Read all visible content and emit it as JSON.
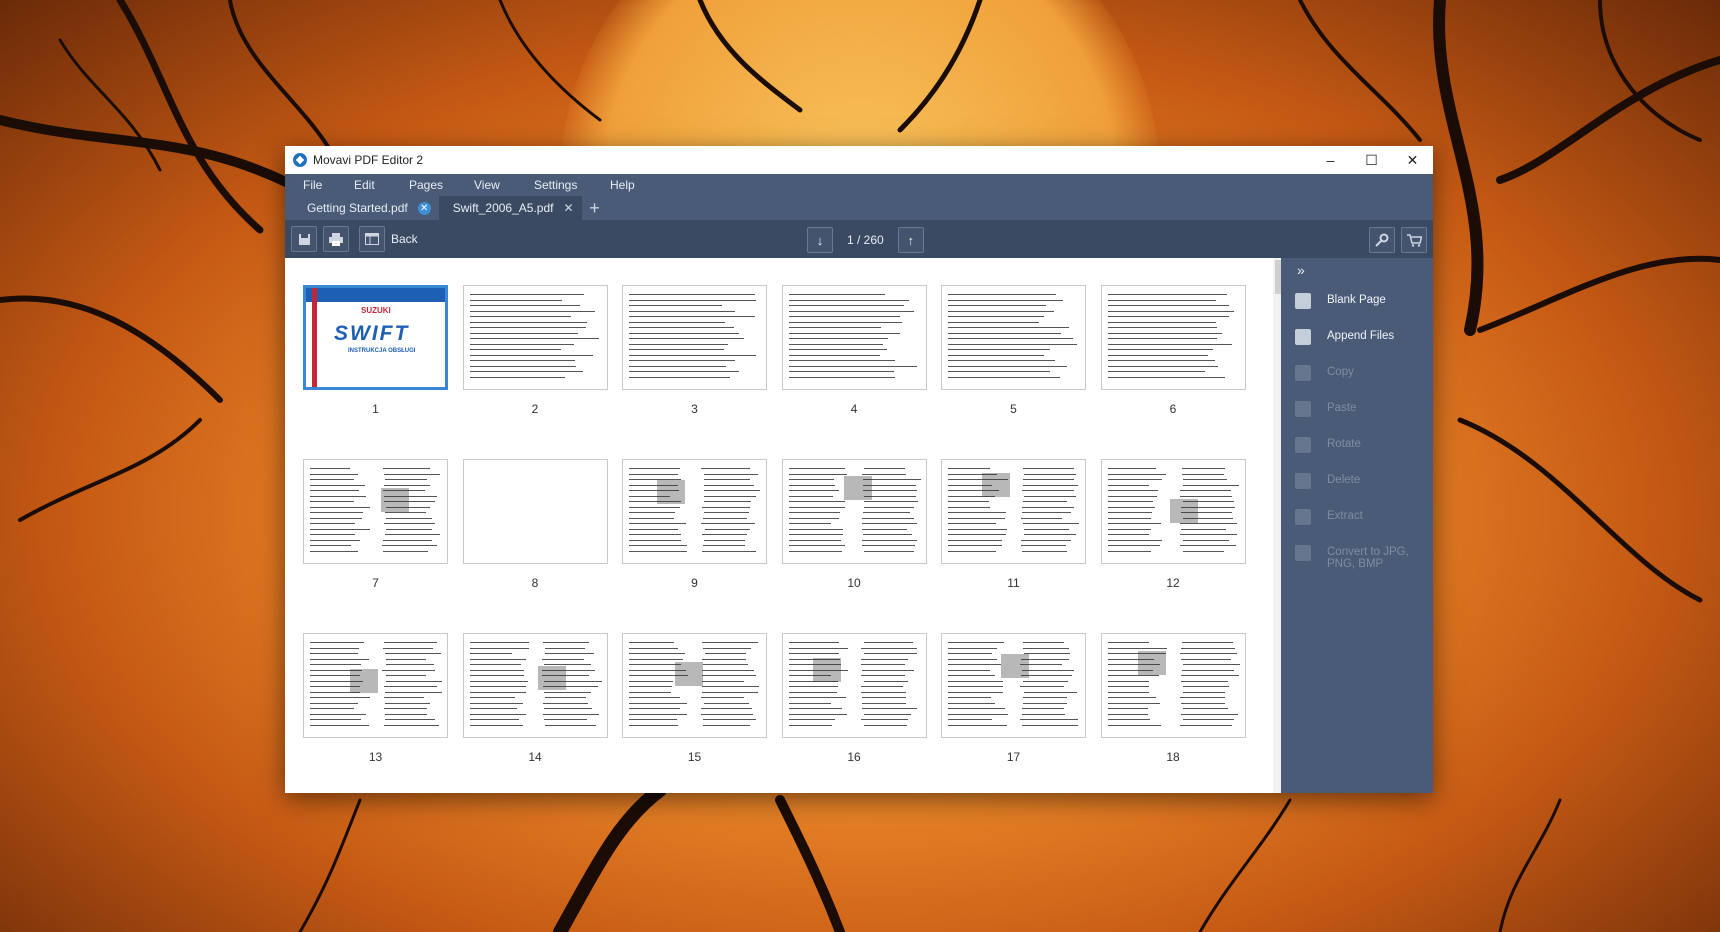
{
  "window": {
    "title": "Movavi PDF Editor 2"
  },
  "menu": [
    "File",
    "Edit",
    "Pages",
    "View",
    "Settings",
    "Help"
  ],
  "tabs": [
    {
      "label": "Getting Started.pdf",
      "active": false
    },
    {
      "label": "Swift_2006_A5.pdf",
      "active": true
    }
  ],
  "toolbar": {
    "back_label": "Back",
    "page_indicator": "1 / 260"
  },
  "pages": [
    {
      "number": "1",
      "selected": true,
      "cover": {
        "brand": "SUZUKI",
        "title": "SWIFT",
        "subtitle": "INSTRUKCJA OBSŁUGI"
      }
    },
    {
      "number": "2"
    },
    {
      "number": "3"
    },
    {
      "number": "4"
    },
    {
      "number": "5"
    },
    {
      "number": "6"
    },
    {
      "number": "7"
    },
    {
      "number": "8"
    },
    {
      "number": "9"
    },
    {
      "number": "10"
    },
    {
      "number": "11"
    },
    {
      "number": "12"
    },
    {
      "number": "13"
    },
    {
      "number": "14"
    },
    {
      "number": "15"
    },
    {
      "number": "16"
    },
    {
      "number": "17"
    },
    {
      "number": "18"
    }
  ],
  "sidebar": {
    "items": [
      {
        "label": "Blank Page",
        "enabled": true
      },
      {
        "label": "Append Files",
        "enabled": true
      },
      {
        "label": "Copy",
        "enabled": false
      },
      {
        "label": "Paste",
        "enabled": false
      },
      {
        "label": "Rotate",
        "enabled": false
      },
      {
        "label": "Delete",
        "enabled": false
      },
      {
        "label": "Extract",
        "enabled": false
      },
      {
        "label": "Convert to JPG, PNG, BMP",
        "enabled": false
      }
    ]
  },
  "colors": {
    "chrome": "#4a5b78",
    "toolbar": "#3b4a63",
    "accent": "#3a86d8"
  }
}
